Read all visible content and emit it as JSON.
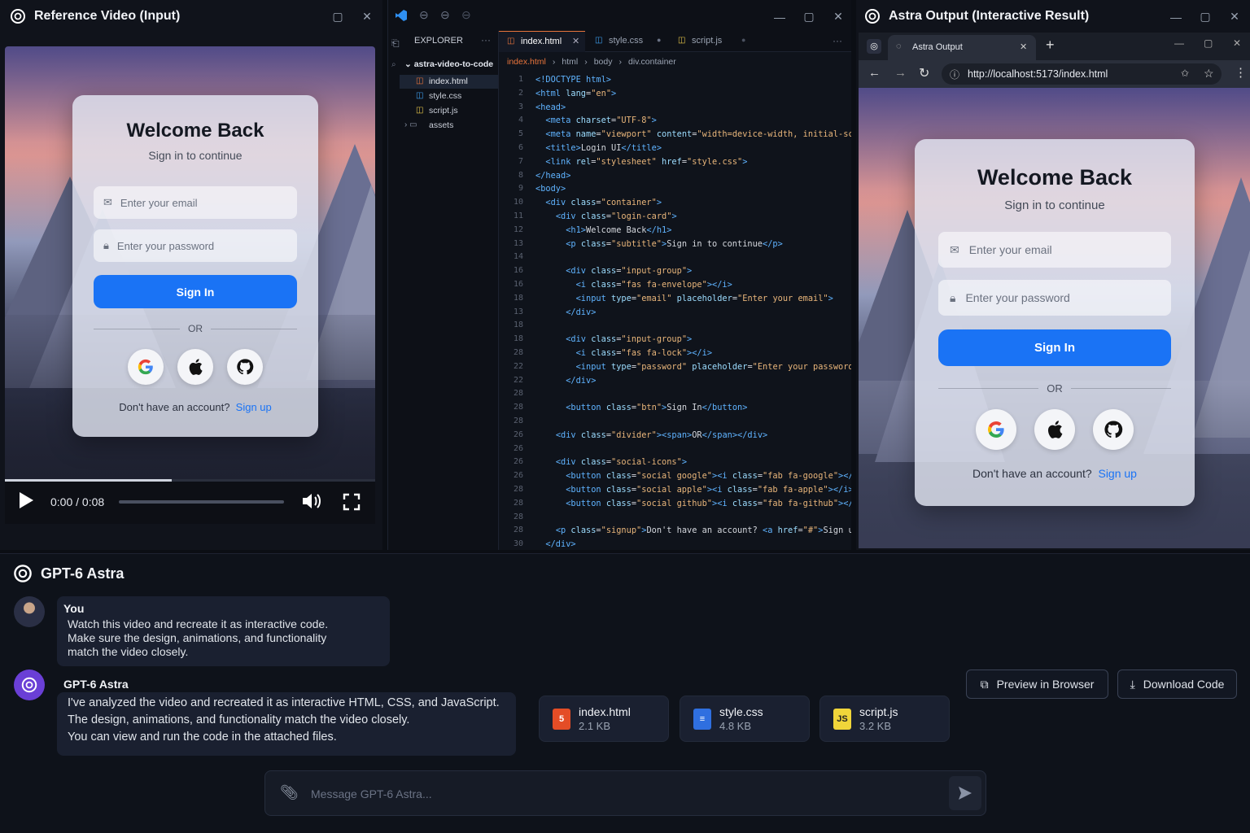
{
  "ref": {
    "title": "Reference Video (Input)",
    "time": "0:00 / 0:08",
    "progress": 0.45
  },
  "login": {
    "heading": "Welcome Back",
    "subtitle": "Sign in to continue",
    "email_placeholder": "Enter your email",
    "password_placeholder": "Enter your password",
    "signin": "Sign In",
    "or": "OR",
    "no_account": "Don't have an account?",
    "signup": "Sign up"
  },
  "editor": {
    "explorer": "EXPLORER",
    "tabs": [
      "index.html",
      "style.css",
      "script.js"
    ],
    "folder": "astra-video-to-code",
    "files": [
      "index.html",
      "style.css",
      "script.js",
      "assets"
    ],
    "breadcrumb": [
      "index.html",
      "html",
      "body",
      "div.container"
    ],
    "line_numbers": [
      "1",
      "2",
      "3",
      "4",
      "5",
      "6",
      "7",
      "8",
      "9",
      "10",
      "11",
      "12",
      "13",
      "14",
      "16",
      "16",
      "18",
      "13",
      "18",
      "18",
      "28",
      "22",
      "22",
      "28",
      "28",
      "28",
      "26",
      "26",
      "26",
      "26",
      "28",
      "28",
      "28",
      "28",
      "30"
    ]
  },
  "browser": {
    "title": "Astra Output (Interactive Result)",
    "tab": "Astra Output",
    "url": "http://localhost:5173/index.html"
  },
  "chat": {
    "title": "GPT-6 Astra",
    "user_name": "You",
    "user_msg": [
      "Watch this video and recreate it as interactive code.",
      "Make sure the design, animations, and functionality",
      "match the video closely."
    ],
    "bot_name": "GPT-6 Astra",
    "bot_msg": [
      "I've analyzed the video and recreated it as interactive HTML, CSS, and JavaScript.",
      "The design, animations, and functionality match the video closely.",
      "You can view and run the code in the attached files."
    ],
    "files": [
      {
        "name": "index.html",
        "size": "2.1 KB"
      },
      {
        "name": "style.css",
        "size": "4.8 KB"
      },
      {
        "name": "script.js",
        "size": "3.2 KB"
      }
    ],
    "preview": "Preview in Browser",
    "download": "Download Code",
    "input_placeholder": "Message GPT-6 Astra..."
  },
  "colors": {
    "accent": "#1a73f5",
    "bg": "#0b0e14"
  }
}
